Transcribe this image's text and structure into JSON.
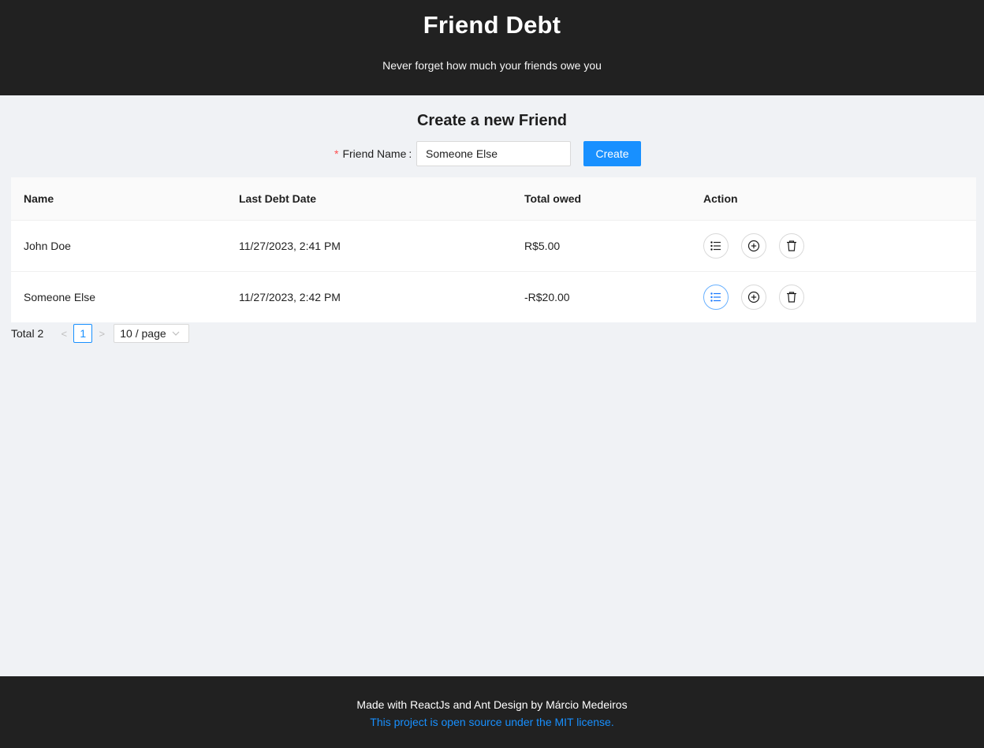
{
  "header": {
    "title": "Friend Debt",
    "subtitle": "Never forget how much your friends owe you"
  },
  "form": {
    "title": "Create a new Friend",
    "required_mark": "*",
    "label": "Friend Name",
    "colon": ":",
    "input_value": "Someone Else",
    "button_label": "Create"
  },
  "table": {
    "columns": [
      "Name",
      "Last Debt Date",
      "Total owed",
      "Action"
    ],
    "rows": [
      {
        "name": "John Doe",
        "date": "11/27/2023, 2:41 PM",
        "owed": "R$5.00"
      },
      {
        "name": "Someone Else",
        "date": "11/27/2023, 2:42 PM",
        "owed": "-R$20.00"
      }
    ],
    "action_icons": [
      "list-icon",
      "plus-circle-icon",
      "delete-icon"
    ]
  },
  "pagination": {
    "total": "Total 2",
    "prev": "<",
    "current": "1",
    "next": ">",
    "page_size": "10 / page"
  },
  "footer": {
    "credit": "Made with ReactJs and Ant Design by Márcio Medeiros",
    "license": "This project is open source under the MIT license."
  },
  "colors": {
    "header_bg": "#212121",
    "primary": "#1890ff",
    "page_bg": "#f0f2f5"
  }
}
